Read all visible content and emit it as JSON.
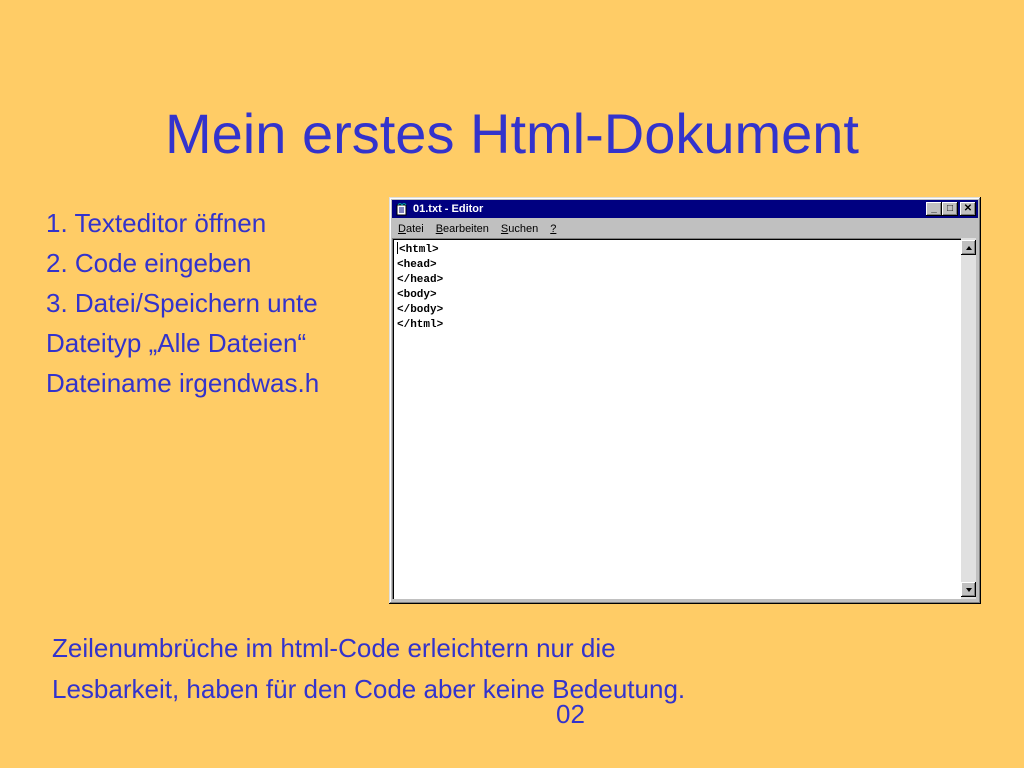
{
  "slide": {
    "title": "Mein erstes Html-Dokument",
    "steps": [
      "1. Texteditor öffnen",
      "2. Code eingeben",
      "3. Datei/Speichern unte",
      "Dateityp „Alle Dateien“",
      "Dateiname irgendwas.h"
    ],
    "note_lines": [
      "Zeilenumbrüche im html-Code erleichtern nur die",
      "Lesbarkeit, haben für den Code aber keine Bedeutung."
    ],
    "page_number": "02",
    "colors": {
      "background": "#FFCC66",
      "text": "#3333CC"
    }
  },
  "editor": {
    "title": "01.txt - Editor",
    "menu": [
      {
        "accel": "D",
        "rest": "atei"
      },
      {
        "accel": "B",
        "rest": "earbeiten"
      },
      {
        "accel": "S",
        "rest": "uchen"
      },
      {
        "accel": "?",
        "rest": ""
      }
    ],
    "window_buttons": {
      "minimize": "_",
      "maximize": "□",
      "close": "✕"
    },
    "content_lines": [
      "<html>",
      "<head>",
      "</head>",
      "<body>",
      "</body>",
      "</html>"
    ],
    "icons": {
      "app": "notepad-icon",
      "scroll_up": "arrow-up-icon",
      "scroll_down": "arrow-down-icon"
    },
    "colors": {
      "titlebar": "#000080",
      "chrome": "#C0C0C0",
      "text_bg": "#FFFFFF"
    }
  }
}
